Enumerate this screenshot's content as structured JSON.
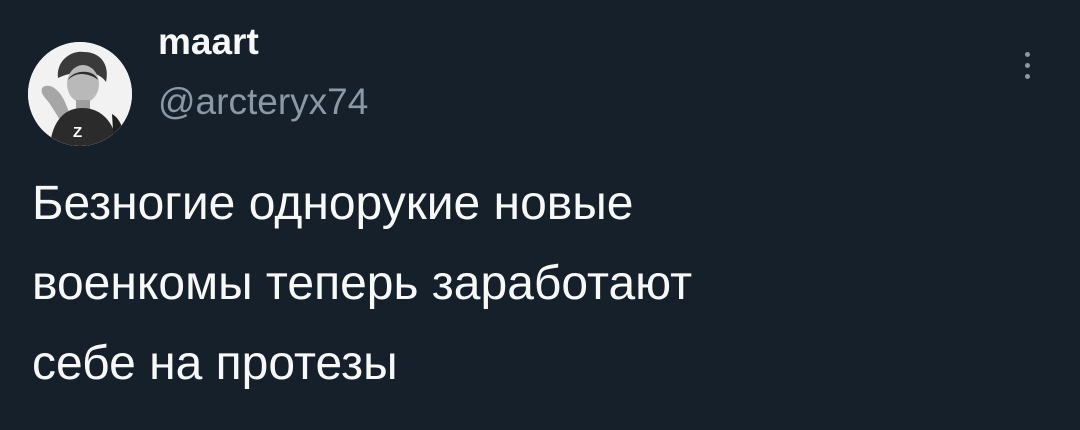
{
  "tweet": {
    "author": {
      "display_name": "maart",
      "handle": "@arcteryx74",
      "avatar_icon": "profile-photo-avatar",
      "avatar_shirt_letter": "Z"
    },
    "more_icon": "more-vertical-icon",
    "text_lines": [
      "Безногие однорукие новые",
      "военкомы теперь заработают",
      "себе на протезы"
    ]
  },
  "colors": {
    "background": "#15202b",
    "primary_text": "#f7f9f9",
    "secondary_text": "#8b98a5"
  }
}
